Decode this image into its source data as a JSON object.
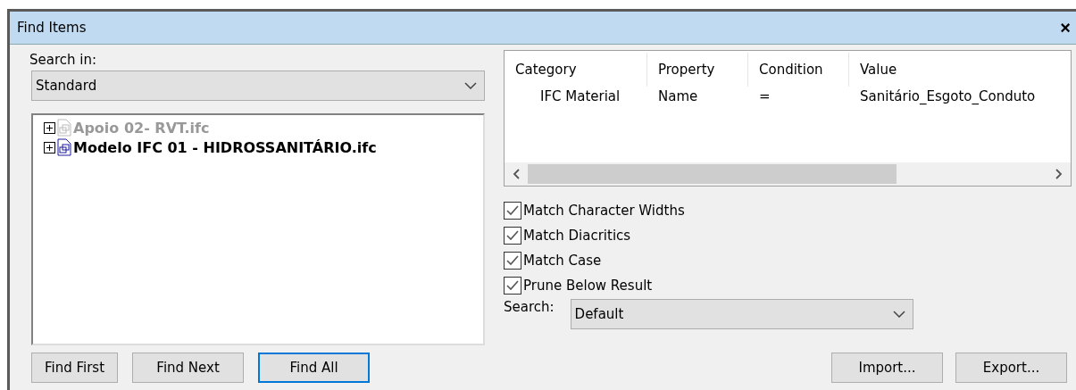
{
  "window": {
    "title": "Find Items",
    "close": "×"
  },
  "search_in": {
    "label": "Search in:",
    "value": "Standard"
  },
  "tree": {
    "items": [
      {
        "label": "Apoio 02- RVT.ifc",
        "disabled": true,
        "expanded": false
      },
      {
        "label": "Modelo IFC 01 - HIDROSSANITÁRIO.ifc",
        "disabled": false,
        "expanded": false
      }
    ]
  },
  "conditions": {
    "columns": [
      "Category",
      "Property",
      "Condition",
      "Value"
    ],
    "rows": [
      [
        "IFC Material",
        "Name",
        "=",
        "Sanitário_Esgoto_Conduto"
      ]
    ]
  },
  "options": [
    {
      "label": "Match Character Widths",
      "checked": true
    },
    {
      "label": "Match Diacritics",
      "checked": true
    },
    {
      "label": "Match Case",
      "checked": true
    },
    {
      "label": "Prune Below Result",
      "checked": true
    }
  ],
  "search": {
    "label": "Search:",
    "value": "Default"
  },
  "buttons_left": [
    {
      "label": "Find First",
      "focused": false
    },
    {
      "label": "Find Next",
      "focused": false
    },
    {
      "label": "Find All",
      "focused": true
    }
  ],
  "buttons_right": [
    {
      "label": "Import...",
      "focused": false
    },
    {
      "label": "Export...",
      "focused": false
    }
  ]
}
